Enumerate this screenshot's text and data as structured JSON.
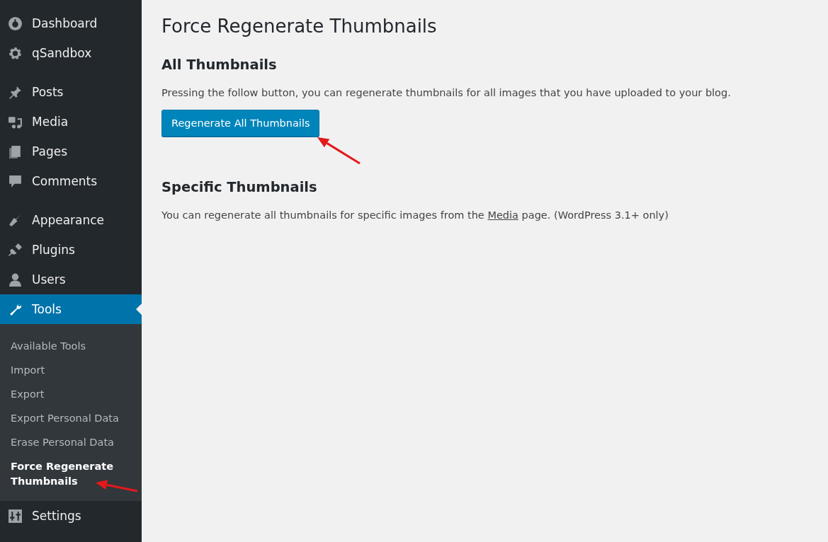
{
  "sidebar": {
    "groups": [
      [
        {
          "label": "Dashboard",
          "selected": false
        },
        {
          "label": "qSandbox",
          "selected": false
        }
      ],
      [
        {
          "label": "Posts",
          "selected": false
        },
        {
          "label": "Media",
          "selected": false
        },
        {
          "label": "Pages",
          "selected": false
        },
        {
          "label": "Comments",
          "selected": false
        }
      ],
      [
        {
          "label": "Appearance",
          "selected": false
        },
        {
          "label": "Plugins",
          "selected": false
        },
        {
          "label": "Users",
          "selected": false
        },
        {
          "label": "Tools",
          "selected": true,
          "children": [
            {
              "label": "Available Tools",
              "selected": false
            },
            {
              "label": "Import",
              "selected": false
            },
            {
              "label": "Export",
              "selected": false
            },
            {
              "label": "Export Personal Data",
              "selected": false
            },
            {
              "label": "Erase Personal Data",
              "selected": false
            },
            {
              "label": "Force Regenerate Thumbnails",
              "selected": true
            }
          ]
        },
        {
          "label": "Settings",
          "selected": false
        }
      ]
    ]
  },
  "page": {
    "title": "Force Regenerate Thumbnails",
    "sections": [
      {
        "heading": "All Thumbnails",
        "text": "Pressing the follow button, you can regenerate thumbnails for all images that you have uploaded to your blog.",
        "button": "Regenerate All Thumbnails"
      },
      {
        "heading": "Specific Thumbnails",
        "text": "You can regenerate all thumbnails for specific images from the ",
        "link": "Media",
        "text_after": " page. (WordPress 3.1+ only)"
      }
    ]
  }
}
